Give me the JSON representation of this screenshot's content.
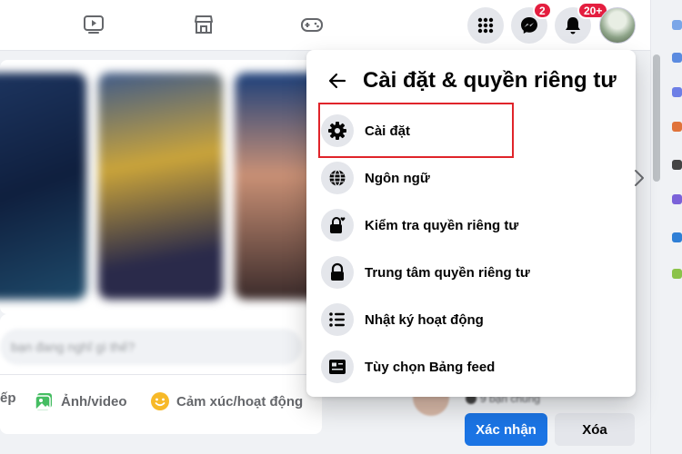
{
  "topbar": {
    "nav_icons": [
      "video-icon",
      "marketplace-icon",
      "gaming-icon"
    ],
    "messenger_badge": "2",
    "notifications_badge": "20+"
  },
  "menu": {
    "title": "Cài đặt & quyền riêng tư",
    "items": [
      {
        "label": "Cài đặt",
        "icon": "gear-icon"
      },
      {
        "label": "Ngôn ngữ",
        "icon": "globe-icon",
        "has_submenu": true
      },
      {
        "label": "Kiểm tra quyền riêng tư",
        "icon": "lock-heart-icon"
      },
      {
        "label": "Trung tâm quyền riêng tư",
        "icon": "lock-icon"
      },
      {
        "label": "Nhật ký hoạt động",
        "icon": "list-icon"
      },
      {
        "label": "Tùy chọn Bảng feed",
        "icon": "feed-icon"
      }
    ]
  },
  "composer": {
    "input_placeholder": "bạn đang nghĩ gì thế?",
    "actions": {
      "live_partial": "ếp",
      "photo": "Ảnh/video",
      "feeling": "Cảm xúc/hoạt động"
    }
  },
  "friend_request": {
    "mutual": "9 bạn chung",
    "confirm": "Xác nhận",
    "delete": "Xóa"
  },
  "colors": {
    "accent": "#1b74e4",
    "badge": "#e41e3f",
    "highlight": "#e0242a"
  }
}
